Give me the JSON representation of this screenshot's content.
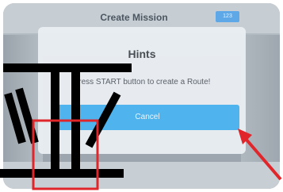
{
  "app": {
    "title": "Create Mission",
    "badge": "123"
  },
  "dialog": {
    "title": "Hints",
    "message": "Press START button to create a Route!",
    "cancel_label": "Cancel"
  },
  "colors": {
    "dialog_bg": "#eaeef2",
    "button_blue": "#4fb3ee",
    "highlight_red": "#e0262a",
    "arrow_red": "#e0262a"
  },
  "annotations": {
    "highlight_box": "red-rectangle-highlight",
    "pointer": "red-arrow"
  }
}
